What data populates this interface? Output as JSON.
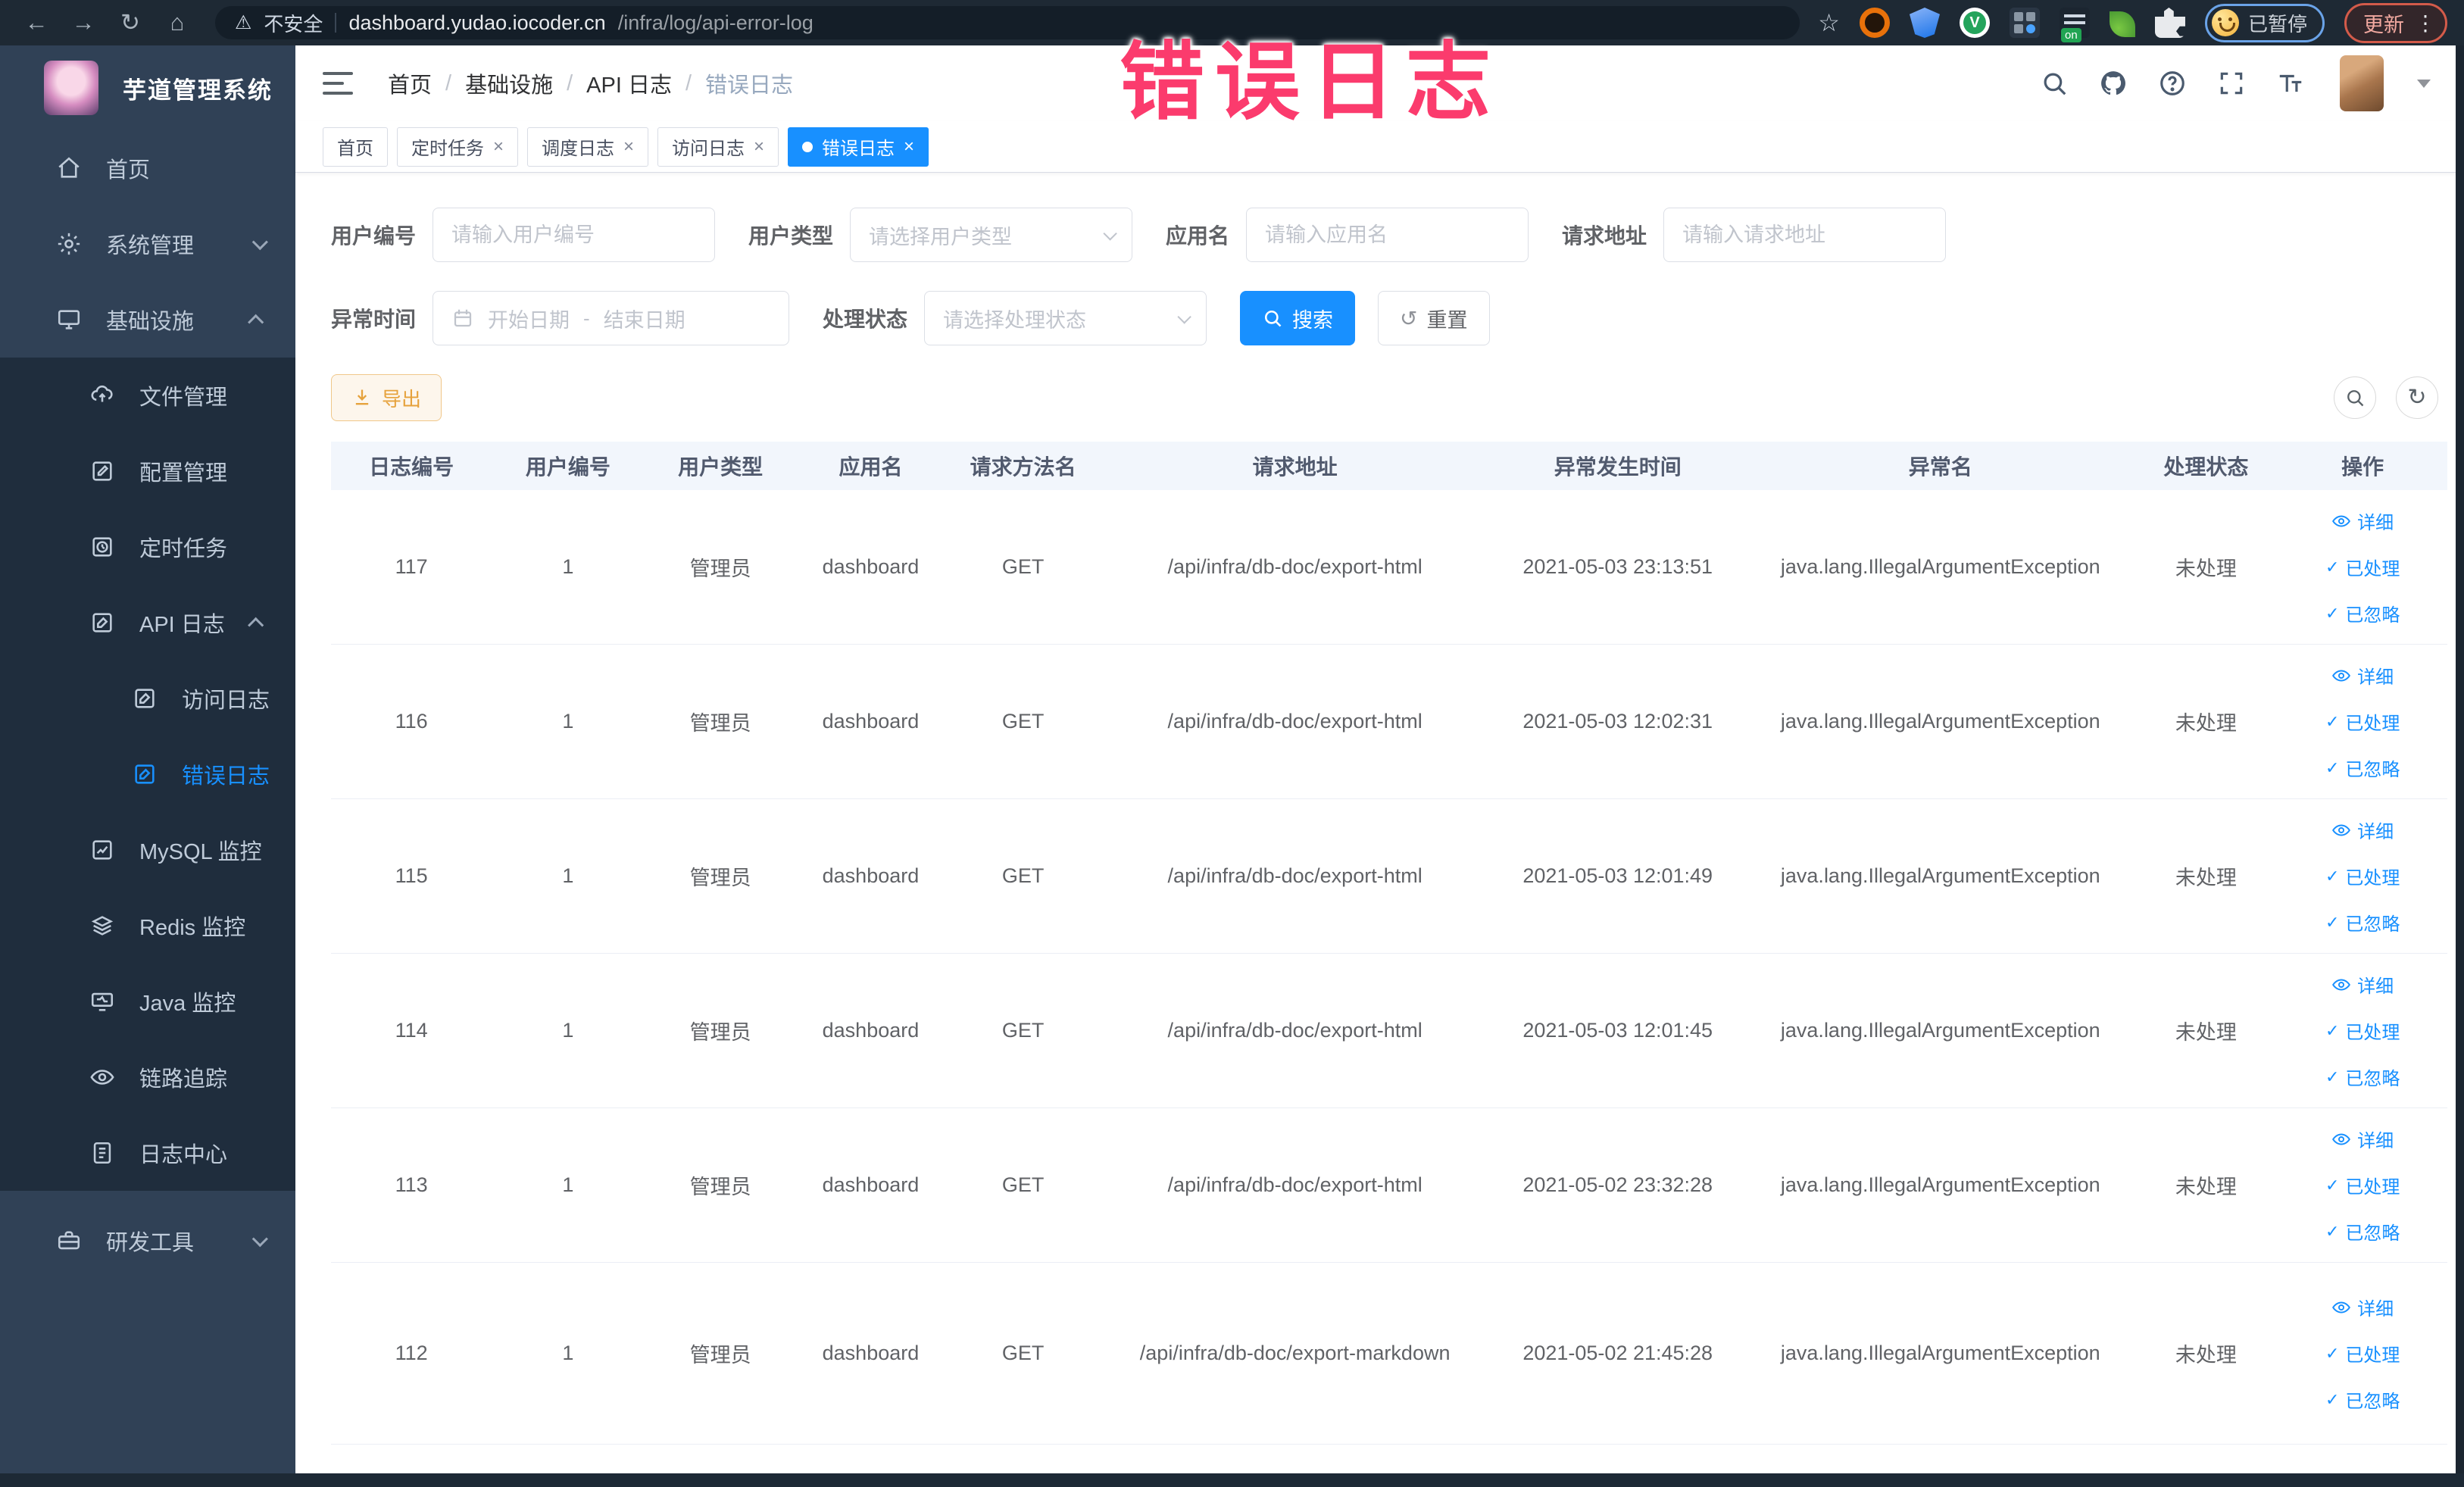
{
  "colors": {
    "accent": "#1890ff",
    "warning": "#e6a23c",
    "annotation": "#fb3b6d",
    "sidebar_bg": "#304156",
    "submenu_bg": "#1f2d3d"
  },
  "icons": {
    "back": "←",
    "forward": "→",
    "reload": "↻",
    "home": "⌂",
    "warning": "⚠",
    "star": "☆",
    "menu_dots": "⋮",
    "close": "×",
    "check": "✓",
    "reset": "↺",
    "refresh": "↻"
  },
  "browser": {
    "security_label": "不安全",
    "url_domain": "dashboard.yudao.iocoder.cn",
    "url_path": "/infra/log/api-error-log",
    "extension_on_badge": "on",
    "paused_label": "已暂停",
    "update_label": "更新"
  },
  "annotation": {
    "text": "错误日志"
  },
  "sidebar": {
    "app_title": "芋道管理系统",
    "menu": [
      {
        "label": "首页"
      },
      {
        "label": "系统管理"
      },
      {
        "label": "基础设施"
      },
      {
        "label": "文件管理"
      },
      {
        "label": "配置管理"
      },
      {
        "label": "定时任务"
      },
      {
        "label": "API 日志"
      },
      {
        "label": "访问日志"
      },
      {
        "label": "错误日志"
      },
      {
        "label": "MySQL 监控"
      },
      {
        "label": "Redis 监控"
      },
      {
        "label": "Java 监控"
      },
      {
        "label": "链路追踪"
      },
      {
        "label": "日志中心"
      },
      {
        "label": "研发工具"
      }
    ]
  },
  "breadcrumb": {
    "separator": "/",
    "items": [
      "首页",
      "基础设施",
      "API 日志",
      "错误日志"
    ]
  },
  "tabs": [
    {
      "label": "首页"
    },
    {
      "label": "定时任务"
    },
    {
      "label": "调度日志"
    },
    {
      "label": "访问日志"
    },
    {
      "label": "错误日志"
    }
  ],
  "filters": {
    "user_id": {
      "label": "用户编号",
      "placeholder": "请输入用户编号",
      "value": ""
    },
    "user_type": {
      "label": "用户类型",
      "placeholder": "请选择用户类型"
    },
    "app_name": {
      "label": "应用名",
      "placeholder": "请输入应用名",
      "value": ""
    },
    "request_url": {
      "label": "请求地址",
      "placeholder": "请输入请求地址",
      "value": ""
    },
    "exception_time": {
      "label": "异常时间",
      "start_placeholder": "开始日期",
      "separator": "-",
      "end_placeholder": "结束日期"
    },
    "process_status": {
      "label": "处理状态",
      "placeholder": "请选择处理状态"
    },
    "search_label": "搜索",
    "reset_label": "重置"
  },
  "toolbar": {
    "export_label": "导出"
  },
  "table": {
    "columns": [
      "日志编号",
      "用户编号",
      "用户类型",
      "应用名",
      "请求方法名",
      "请求地址",
      "异常发生时间",
      "异常名",
      "处理状态",
      "操作"
    ],
    "action_labels": {
      "detail": "详细",
      "processed": "已处理",
      "ignored": "已忽略"
    },
    "rows": [
      {
        "id": "117",
        "user_id": "1",
        "user_type": "管理员",
        "app_name": "dashboard",
        "method": "GET",
        "url": "/api/infra/db-doc/export-html",
        "time": "2021-05-03 23:13:51",
        "exception": "java.lang.IllegalArgumentException",
        "status": "未处理"
      },
      {
        "id": "116",
        "user_id": "1",
        "user_type": "管理员",
        "app_name": "dashboard",
        "method": "GET",
        "url": "/api/infra/db-doc/export-html",
        "time": "2021-05-03 12:02:31",
        "exception": "java.lang.IllegalArgumentException",
        "status": "未处理"
      },
      {
        "id": "115",
        "user_id": "1",
        "user_type": "管理员",
        "app_name": "dashboard",
        "method": "GET",
        "url": "/api/infra/db-doc/export-html",
        "time": "2021-05-03 12:01:49",
        "exception": "java.lang.IllegalArgumentException",
        "status": "未处理"
      },
      {
        "id": "114",
        "user_id": "1",
        "user_type": "管理员",
        "app_name": "dashboard",
        "method": "GET",
        "url": "/api/infra/db-doc/export-html",
        "time": "2021-05-03 12:01:45",
        "exception": "java.lang.IllegalArgumentException",
        "status": "未处理"
      },
      {
        "id": "113",
        "user_id": "1",
        "user_type": "管理员",
        "app_name": "dashboard",
        "method": "GET",
        "url": "/api/infra/db-doc/export-html",
        "time": "2021-05-02 23:32:28",
        "exception": "java.lang.IllegalArgumentException",
        "status": "未处理"
      },
      {
        "id": "112",
        "user_id": "1",
        "user_type": "管理员",
        "app_name": "dashboard",
        "method": "GET",
        "url": "/api/infra/db-doc/export-markdown",
        "time": "2021-05-02 21:45:28",
        "exception": "java.lang.IllegalArgumentException",
        "status": "未处理"
      }
    ]
  }
}
